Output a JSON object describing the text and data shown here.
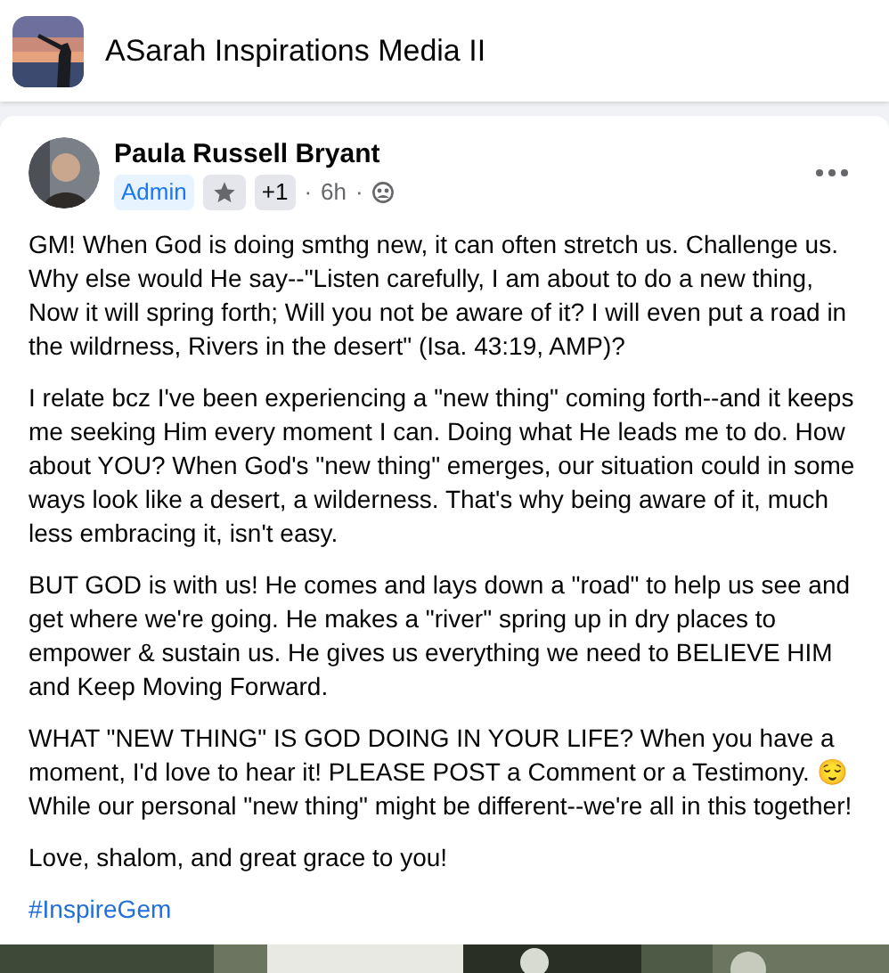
{
  "group": {
    "name": "ASarah Inspirations Media II"
  },
  "post": {
    "author": "Paula Russell Bryant",
    "badges": [
      {
        "kind": "text",
        "label": "Admin"
      },
      {
        "kind": "icon"
      },
      {
        "kind": "count",
        "label": "+1"
      }
    ],
    "time": "6h",
    "separator": "·",
    "paragraphs": [
      "GM! When God is doing smthg new, it can often stretch us. Challenge us. Why else would He say--\"Listen carefully, I am about to do a new thing, Now it will spring forth; Will you not be aware of it? I will even put a road in the wildrness, Rivers in the desert\" (Isa. 43:19, AMP)?",
      "I relate bcz I've been experiencing a \"new thing\" coming forth--and it keeps me seeking Him every moment I can. Doing what He leads me to do. How about YOU? When God's \"new thing\" emerges, our situation could in some ways look like a desert, a wilderness. That's why being aware of it, much less embracing it, isn't easy.",
      "BUT GOD is with us! He comes and lays down a \"road\" to help us see and get where we're going. He makes a \"river\" spring up in dry places to empower & sustain us. He gives us everything we need to BELIEVE HIM and Keep Moving Forward.",
      "WHAT \"NEW THING\" IS GOD DOING IN YOUR LIFE? When you have a moment, I'd love to hear it! PLEASE POST a Comment or a Testimony. 😌 While our personal \"new thing\" might be different--we're all in this together!",
      "Love, shalom, and great grace to you!"
    ],
    "hashtag": "#InspireGem"
  }
}
